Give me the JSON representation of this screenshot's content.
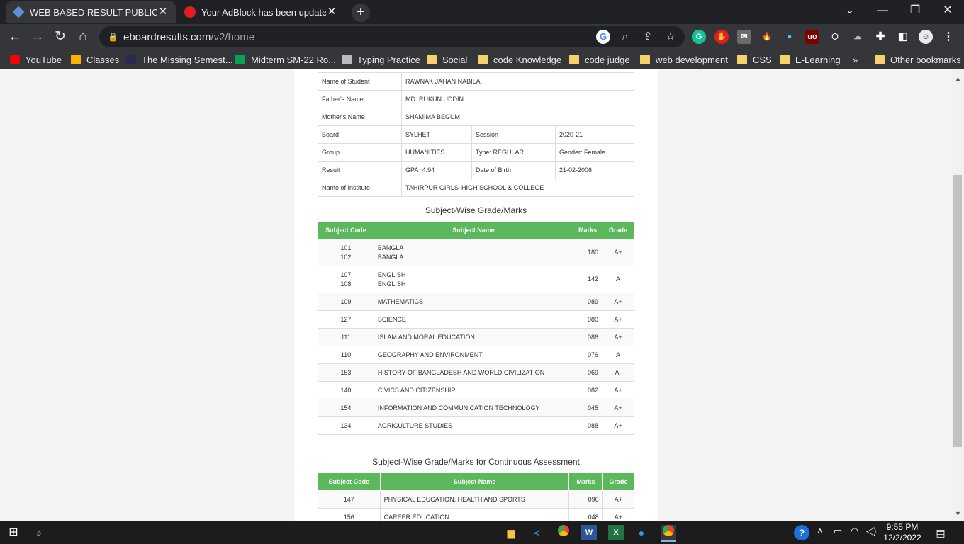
{
  "browser": {
    "tabs": [
      {
        "title": "WEB BASED RESULT PUBLICATION",
        "active": true
      },
      {
        "title": "Your AdBlock has been updated!",
        "active": false
      }
    ],
    "url_domain": "eboardresults.com",
    "url_path": "/v2/home",
    "bookmarks": [
      "YouTube",
      "Classes",
      "The Missing Semest...",
      "Midterm SM-22 Ro...",
      "Typing Practice",
      "Social",
      "code Knowledge",
      "code judge",
      "web development",
      "CSS",
      "E-Learning",
      "»",
      "Other bookmarks"
    ]
  },
  "student_info": {
    "rows": [
      [
        {
          "label": "Name of Student"
        },
        {
          "value": "RAWNAK JAHAN NABILA"
        }
      ],
      [
        {
          "label": "Father's Name"
        },
        {
          "value": "MD. RUKUN UDDIN"
        }
      ],
      [
        {
          "label": "Mother's Name"
        },
        {
          "value": "SHAMIMA BEGUM"
        }
      ],
      [
        {
          "label": "Board"
        },
        {
          "value": "SYLHET"
        },
        {
          "label": "Session"
        },
        {
          "value": "2020-21"
        }
      ],
      [
        {
          "label": "Group"
        },
        {
          "value": "HUMANITIES"
        },
        {
          "label": "Type: REGULAR"
        },
        {
          "value": "Gender: Female"
        }
      ],
      [
        {
          "label": "Result"
        },
        {
          "value": "GPA=4.94"
        },
        {
          "label": "Date of Birth"
        },
        {
          "value": "21-02-2006"
        }
      ],
      [
        {
          "label": "Name of Institute"
        },
        {
          "value": "TAHIRPUR GIRLS' HIGH SCHOOL & COLLEGE"
        }
      ]
    ]
  },
  "subject_grades": {
    "title": "Subject-Wise Grade/Marks",
    "headers": [
      "Subject Code",
      "Subject Name",
      "Marks",
      "Grade"
    ],
    "rows": [
      {
        "codes": [
          "101",
          "102"
        ],
        "names": [
          "BANGLA",
          "BANGLA"
        ],
        "marks": "180",
        "grade": "A+"
      },
      {
        "codes": [
          "107",
          "108"
        ],
        "names": [
          "ENGLISH",
          "ENGLISH"
        ],
        "marks": "142",
        "grade": "A"
      },
      {
        "codes": [
          "109"
        ],
        "names": [
          "MATHEMATICS"
        ],
        "marks": "089",
        "grade": "A+"
      },
      {
        "codes": [
          "127"
        ],
        "names": [
          "SCIENCE"
        ],
        "marks": "080",
        "grade": "A+"
      },
      {
        "codes": [
          "111"
        ],
        "names": [
          "ISLAM AND MORAL EDUCATION"
        ],
        "marks": "086",
        "grade": "A+"
      },
      {
        "codes": [
          "110"
        ],
        "names": [
          "GEOGRAPHY AND ENVIRONMENT"
        ],
        "marks": "076",
        "grade": "A"
      },
      {
        "codes": [
          "153"
        ],
        "names": [
          "HISTORY OF BANGLADESH AND WORLD CIVILIZATION"
        ],
        "marks": "069",
        "grade": "A-"
      },
      {
        "codes": [
          "140"
        ],
        "names": [
          "CIVICS AND CITIZENSHIP"
        ],
        "marks": "082",
        "grade": "A+"
      },
      {
        "codes": [
          "154"
        ],
        "names": [
          "INFORMATION AND COMMUNICATION TECHNOLOGY"
        ],
        "marks": "045",
        "grade": "A+"
      },
      {
        "codes": [
          "134"
        ],
        "names": [
          "AGRICULTURE STUDIES"
        ],
        "marks": "088",
        "grade": "A+"
      }
    ]
  },
  "continuous_assessment": {
    "title": "Subject-Wise Grade/Marks for Continuous Assessment",
    "headers": [
      "Subject Code",
      "Subject Name",
      "Marks",
      "Grade"
    ],
    "rows": [
      {
        "codes": [
          "147"
        ],
        "names": [
          "PHYSICAL EDUCATION, HEALTH AND SPORTS"
        ],
        "marks": "096",
        "grade": "A+"
      },
      {
        "codes": [
          "156"
        ],
        "names": [
          "CAREER EDUCATION"
        ],
        "marks": "048",
        "grade": "A+"
      }
    ]
  },
  "taskbar": {
    "time": "9:55 PM",
    "date": "12/2/2022"
  },
  "colors": {
    "header_green": "#5cb85c",
    "chrome_dark": "#202124",
    "chrome_toolbar": "#35363a"
  }
}
